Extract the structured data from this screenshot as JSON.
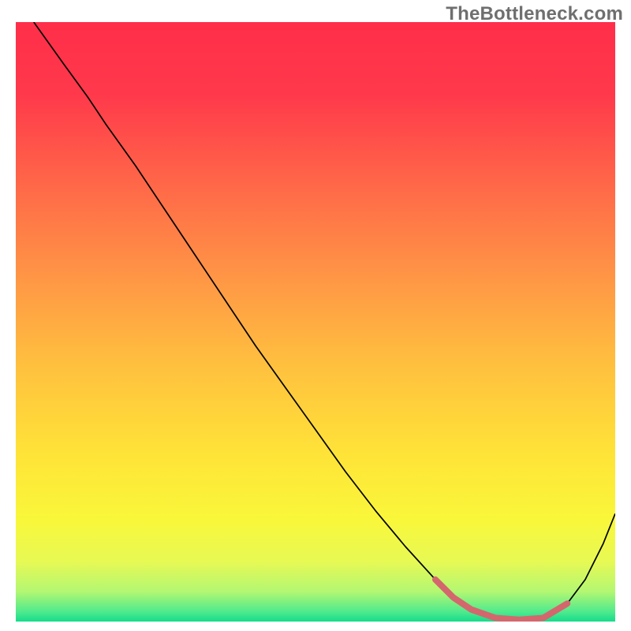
{
  "watermark": "TheBottleneck.com",
  "chart_data": {
    "type": "line",
    "title": "",
    "xlabel": "",
    "ylabel": "",
    "xlim": [
      0,
      100
    ],
    "ylim": [
      0,
      100
    ],
    "grid": false,
    "legend": false,
    "series": [
      {
        "name": "bottleneck-curve",
        "stroke": "#000000",
        "stroke_width": 1.7,
        "x": [
          3,
          8,
          12,
          15,
          20,
          25,
          30,
          35,
          40,
          45,
          50,
          55,
          60,
          65,
          70,
          73,
          76,
          80,
          84,
          88,
          92,
          95,
          98,
          100
        ],
        "y": [
          100,
          93,
          87.5,
          83,
          76,
          68.5,
          61,
          53.5,
          46,
          39,
          32,
          25,
          18.5,
          12.5,
          7,
          4,
          2,
          0.6,
          0.3,
          0.6,
          3,
          7,
          13,
          18
        ]
      },
      {
        "name": "optimal-band",
        "stroke": "#d4676d",
        "stroke_width": 8,
        "linecap": "round",
        "x": [
          70,
          73,
          76,
          80,
          84,
          88,
          92
        ],
        "y": [
          7,
          4,
          2,
          0.6,
          0.3,
          0.6,
          3
        ]
      }
    ],
    "background_gradient": {
      "stops": [
        {
          "offset": 0.0,
          "color": "#ff2e4a"
        },
        {
          "offset": 0.12,
          "color": "#ff394b"
        },
        {
          "offset": 0.28,
          "color": "#ff6a48"
        },
        {
          "offset": 0.44,
          "color": "#ff9a45"
        },
        {
          "offset": 0.58,
          "color": "#ffc23e"
        },
        {
          "offset": 0.72,
          "color": "#ffe338"
        },
        {
          "offset": 0.83,
          "color": "#f9f73a"
        },
        {
          "offset": 0.9,
          "color": "#e7f954"
        },
        {
          "offset": 0.95,
          "color": "#b3f772"
        },
        {
          "offset": 0.985,
          "color": "#4be98e"
        },
        {
          "offset": 1.0,
          "color": "#15dc8a"
        }
      ]
    }
  }
}
